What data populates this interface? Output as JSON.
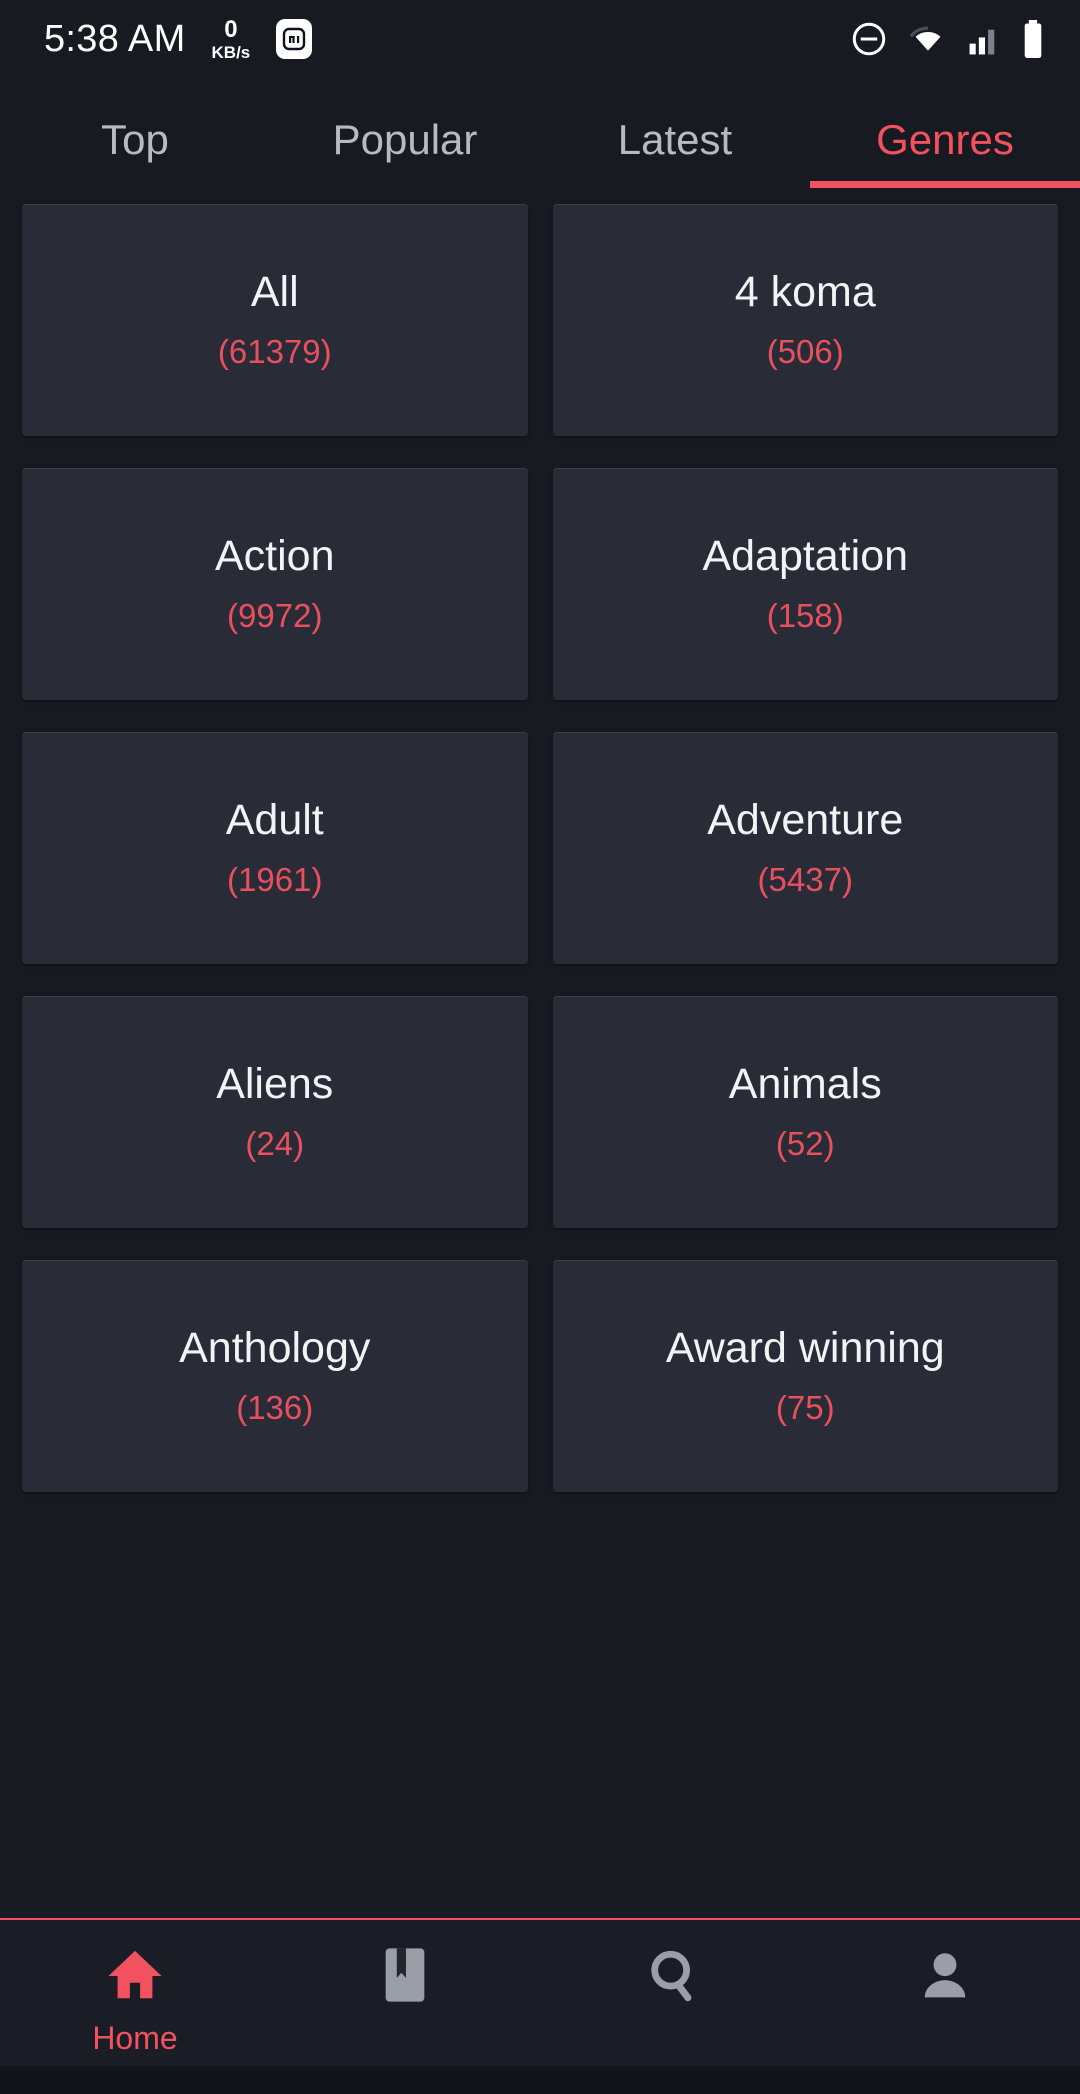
{
  "statusbar": {
    "time": "5:38 AM",
    "network_speed_value": "0",
    "network_speed_unit": "KB/s",
    "app_icon": "mi-app-icon",
    "icons": [
      "dnd-icon",
      "wifi-icon",
      "cellular-signal-icon",
      "battery-icon"
    ]
  },
  "tabs": [
    {
      "label": "Top",
      "active": false
    },
    {
      "label": "Popular",
      "active": false
    },
    {
      "label": "Latest",
      "active": false
    },
    {
      "label": "Genres",
      "active": true
    }
  ],
  "genres": [
    {
      "name": "All",
      "count": "(61379)"
    },
    {
      "name": "4 koma",
      "count": "(506)"
    },
    {
      "name": "Action",
      "count": "(9972)"
    },
    {
      "name": "Adaptation",
      "count": "(158)"
    },
    {
      "name": "Adult",
      "count": "(1961)"
    },
    {
      "name": "Adventure",
      "count": "(5437)"
    },
    {
      "name": "Aliens",
      "count": "(24)"
    },
    {
      "name": "Animals",
      "count": "(52)"
    },
    {
      "name": "Anthology",
      "count": "(136)"
    },
    {
      "name": "Award winning",
      "count": "(75)"
    }
  ],
  "bottom_nav": [
    {
      "icon": "home-icon",
      "label": "Home",
      "active": true
    },
    {
      "icon": "bookmark-icon",
      "label": "",
      "active": false
    },
    {
      "icon": "search-icon",
      "label": "",
      "active": false
    },
    {
      "icon": "profile-icon",
      "label": "",
      "active": false
    }
  ],
  "colors": {
    "accent": "#f2515f",
    "card_bg": "#292c36",
    "page_bg": "#171a21",
    "count_text": "#e8505f",
    "tab_inactive": "#b6bac2"
  }
}
